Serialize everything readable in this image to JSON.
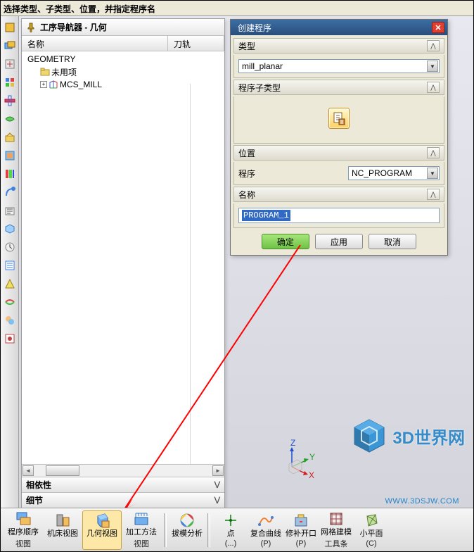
{
  "instruction": "选择类型、子类型、位置，并指定程序名",
  "navigator": {
    "title": "工序导航器 - 几何",
    "columns": {
      "name": "名称",
      "track": "刀轨"
    },
    "tree": {
      "root": "GEOMETRY",
      "unused": "未用项",
      "mcs": "MCS_MILL"
    },
    "dependency": "相依性",
    "detail": "细节"
  },
  "dialog": {
    "title": "创建程序",
    "type_label": "类型",
    "type_value": "mill_planar",
    "subtype_label": "程序子类型",
    "location_label": "位置",
    "program_label": "程序",
    "program_value": "NC_PROGRAM",
    "name_label": "名称",
    "name_value": "PROGRAM_1",
    "ok": "确定",
    "apply": "应用",
    "cancel": "取消"
  },
  "toolbar": {
    "program_order": "程序顺序",
    "program_order_sub": "视图",
    "machine_view": "机床视图",
    "geometry_view": "几何视图",
    "method_view": "加工方法",
    "method_view_sub": "视图",
    "draft_analysis": "拔模分析",
    "point": "点",
    "point_sub": "(...)",
    "composite_curve": "复合曲线",
    "composite_sub": "(P)",
    "repair_open": "修补开口",
    "repair_sub": "(P)",
    "mesh_model": "网格建模",
    "mesh_sub": "工具条",
    "mini_face": "小平面",
    "mini_sub": "(C)"
  },
  "triad": {
    "x": "X",
    "y": "Y",
    "z": "Z"
  },
  "watermark": {
    "text": "3D世界网",
    "url": "WWW.3DSJW.COM"
  }
}
